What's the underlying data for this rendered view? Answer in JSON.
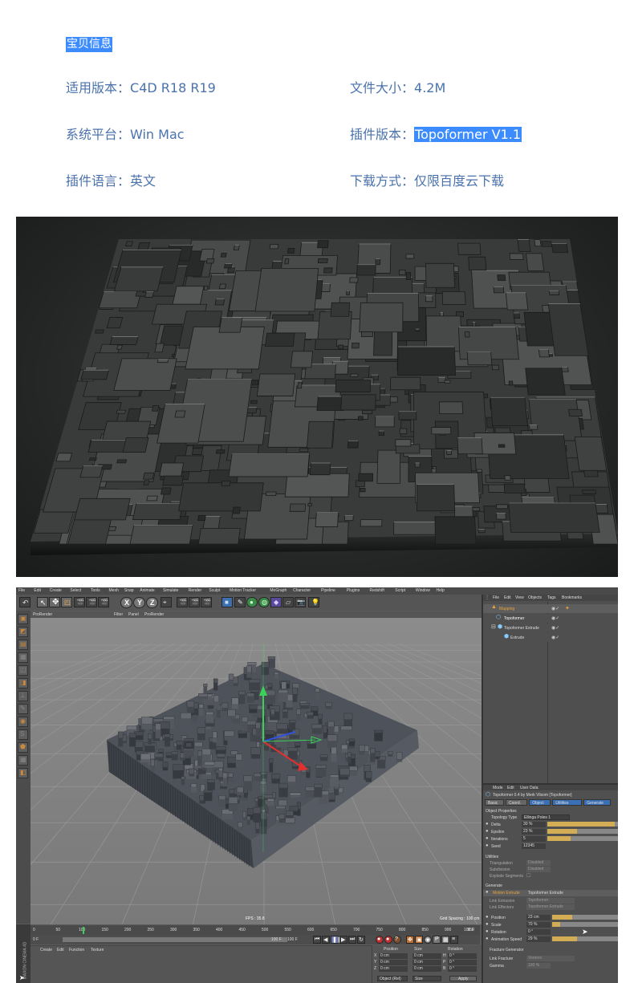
{
  "header": {
    "title": "宝贝信息",
    "rows": [
      {
        "label": "适用版本：",
        "value": "C4D R18 R19"
      },
      {
        "label": "文件大小：",
        "value": "4.2M"
      },
      {
        "label": "系统平台：",
        "value": "Win Mac"
      },
      {
        "label": "插件版本：",
        "value": "Topoformer V1.1"
      },
      {
        "label": "插件语言：",
        "value": "英文"
      },
      {
        "label": "下载方式：",
        "value": "仅限百度云下载"
      }
    ]
  },
  "c4d": {
    "menu": [
      "File",
      "Edit",
      "Create",
      "Select",
      "Tools",
      "Mesh",
      "Snap",
      "Animate",
      "Simulate",
      "Render",
      "Sculpt",
      "Motion Tracker",
      "MoGraph",
      "Character",
      "Pipeline",
      "Plugins",
      "Redshift",
      "Script",
      "Window",
      "Help"
    ],
    "viewport_tab": "ProRender",
    "viewport_menu": [
      "Filter",
      "Panel",
      "ProRender"
    ],
    "fps": "FPS : 35.8",
    "grid_spacing": "Grid Spacing : 100 cm",
    "timeline_ticks": [
      "0",
      "50",
      "100",
      "150",
      "200",
      "250",
      "300",
      "350",
      "400",
      "450",
      "500",
      "550",
      "600",
      "650",
      "700",
      "750",
      "800",
      "850",
      "900",
      "950"
    ],
    "timeline_end": "100 F",
    "start_frame": "0 F",
    "end_frame": "100 F",
    "bottom_menu": [
      "Create",
      "Edit",
      "Function",
      "Texture"
    ],
    "coords": {
      "headers": [
        "Position",
        "Size",
        "Rotation"
      ],
      "rows": [
        {
          "axis": "X",
          "pos": "0 cm",
          "size": "0 cm",
          "rot": "H",
          "rot_val": "0 °"
        },
        {
          "axis": "Y",
          "pos": "0 cm",
          "size": "0 cm",
          "rot": "P",
          "rot_val": "0 °"
        },
        {
          "axis": "Z",
          "pos": "0 cm",
          "size": "0 cm",
          "rot": "B",
          "rot_val": "0 °"
        }
      ],
      "mode": "Object (Rel)",
      "size_mode": "Size",
      "apply": "Apply"
    },
    "object_manager": {
      "menu": [
        "File",
        "Edit",
        "View",
        "Objects",
        "Tags",
        "Bookmarks"
      ],
      "items": [
        {
          "name": "Mapping",
          "color": "#e8a43a"
        },
        {
          "name": "Topoformer",
          "color": "#ffffff"
        },
        {
          "name": "Topoformer Extrude",
          "color": "#dddddd"
        },
        {
          "name": "Extrude",
          "color": "#dddddd"
        }
      ]
    },
    "attributes": {
      "menu": [
        "Mode",
        "Edit",
        "User Data"
      ],
      "object_title": "Topoformer 0.4 by Merk Vilsom [Topoformer]",
      "tabs": [
        "Basic",
        "Coord.",
        "Object",
        "Utilities",
        "Generate"
      ],
      "section_object": "Object Properties",
      "topology_label": "Topology Type",
      "topology_value": "Ellinga Poles 1",
      "params": [
        {
          "label": "Delta",
          "value": "30 %",
          "fill": 0.95
        },
        {
          "label": "Epsilon",
          "value": "23 %",
          "fill": 0.42
        },
        {
          "label": "Iterations",
          "value": "5",
          "fill": 0.33
        },
        {
          "label": "Seed",
          "value": "12345",
          "fill": 0
        }
      ],
      "section_utilities": "Utilities",
      "utilities": [
        {
          "label": "Triangulation",
          "value": "Disabled"
        },
        {
          "label": "Subdivision",
          "value": "Disabled"
        },
        {
          "label": "Explode Segments",
          "value": ""
        }
      ],
      "section_generate": "Generate",
      "motion_extrude_label": "Motion Extrude",
      "motion_extrude_value": "Topoformer Extrude",
      "links": [
        {
          "label": "Link Extrusion",
          "value": "Topoformer"
        },
        {
          "label": "Link Effectors",
          "value": "Topoformer Extrude"
        }
      ],
      "gen_params": [
        {
          "label": "Position",
          "value": "23 cm",
          "fill": 0.3
        },
        {
          "label": "Scale",
          "value": "70 %",
          "fill": 0.12
        },
        {
          "label": "Rotation",
          "value": "0 °",
          "fill": 0
        },
        {
          "label": "Animation Speed",
          "value": "29 %",
          "fill": 0.38
        }
      ],
      "fracture_label": "Fracture Generator",
      "link_fracture_label": "Link Fracture",
      "link_fracture_value": "Voronoi",
      "gamma_label": "Gamma",
      "gamma_value": "100 %"
    },
    "brand": "MAXON CINEMA 4D"
  }
}
